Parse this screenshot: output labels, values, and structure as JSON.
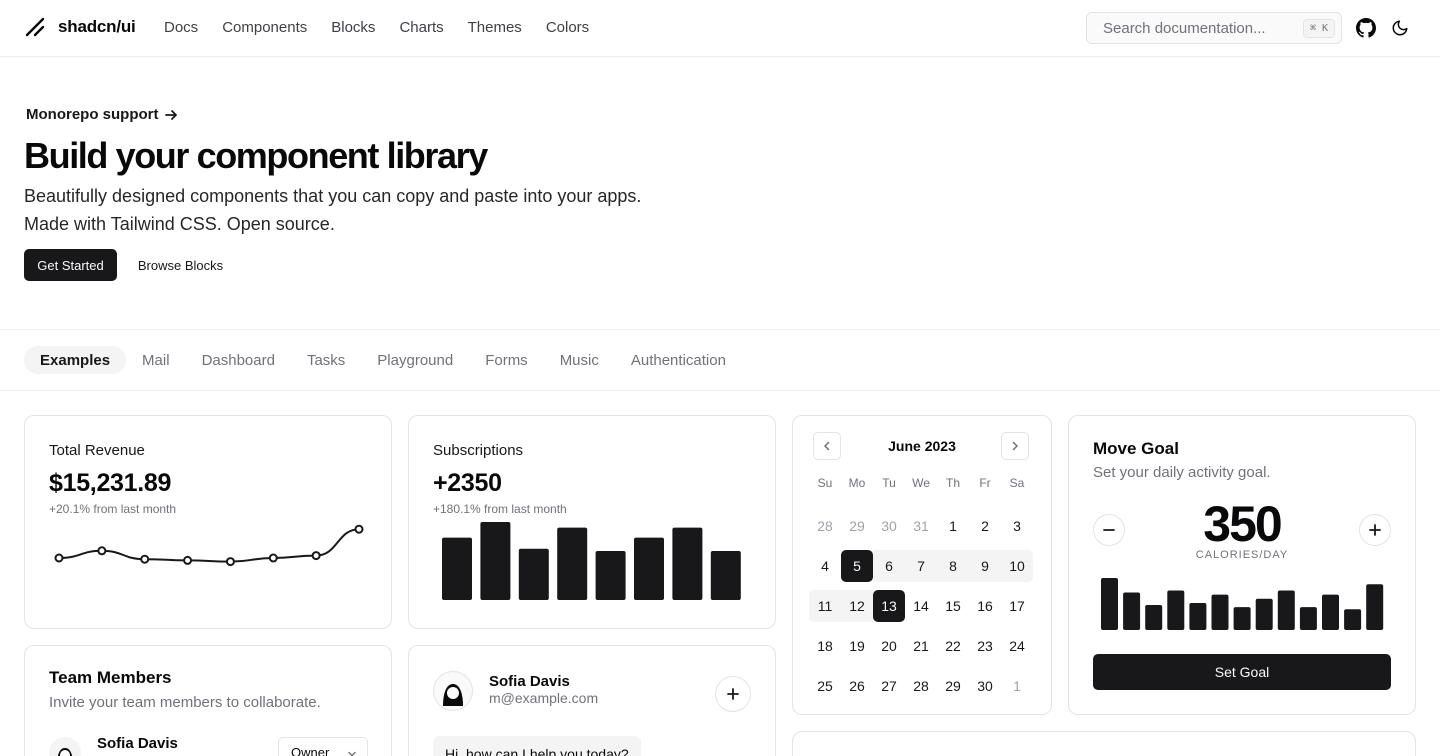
{
  "header": {
    "brand": "shadcn/ui",
    "nav": [
      "Docs",
      "Components",
      "Blocks",
      "Charts",
      "Themes",
      "Colors"
    ],
    "search_placeholder": "Search documentation...",
    "search_shortcut": "⌘ K"
  },
  "hero": {
    "announcement": "Monorepo support",
    "title": "Build your component library",
    "lead_line1": "Beautifully designed components that you can copy and paste into your apps.",
    "lead_line2": "Made with Tailwind CSS. Open source.",
    "primary_cta": "Get Started",
    "secondary_cta": "Browse Blocks"
  },
  "tabs": {
    "items": [
      "Examples",
      "Mail",
      "Dashboard",
      "Tasks",
      "Playground",
      "Forms",
      "Music",
      "Authentication"
    ],
    "active": "Examples"
  },
  "revenue": {
    "label": "Total Revenue",
    "value": "$15,231.89",
    "delta": "+20.1% from last month",
    "chart_data": {
      "type": "line",
      "values": [
        10,
        13,
        9.5,
        9,
        8.5,
        10,
        11,
        22
      ],
      "ylim": [
        0,
        25
      ]
    }
  },
  "subscriptions": {
    "label": "Subscriptions",
    "value": "+2350",
    "delta": "+180.1% from last month",
    "chart_data": {
      "type": "bar",
      "values": [
        56,
        70,
        46,
        65,
        44,
        56,
        65,
        44
      ],
      "ylim": [
        0,
        70
      ]
    }
  },
  "calendar": {
    "title": "June 2023",
    "weekdays": [
      "Su",
      "Mo",
      "Tu",
      "We",
      "Th",
      "Fr",
      "Sa"
    ],
    "weeks": [
      [
        "28",
        "29",
        "30",
        "31",
        "1",
        "2",
        "3"
      ],
      [
        "4",
        "5",
        "6",
        "7",
        "8",
        "9",
        "10"
      ],
      [
        "11",
        "12",
        "13",
        "14",
        "15",
        "16",
        "17"
      ],
      [
        "18",
        "19",
        "20",
        "21",
        "22",
        "23",
        "24"
      ],
      [
        "25",
        "26",
        "27",
        "28",
        "29",
        "30",
        "1"
      ]
    ]
  },
  "goal": {
    "title": "Move Goal",
    "description": "Set your daily activity goal.",
    "value": "350",
    "unit": "CALORIES/DAY",
    "button": "Set Goal",
    "chart_data": {
      "type": "bar",
      "values": [
        50,
        36,
        24,
        38,
        26,
        34,
        22,
        30,
        38,
        22,
        34,
        20,
        44
      ],
      "ylim": [
        0,
        50
      ]
    }
  },
  "team": {
    "title": "Team Members",
    "description": "Invite your team members to collaborate.",
    "member_name": "Sofia Davis",
    "member_role": "Owner"
  },
  "chat": {
    "name": "Sofia Davis",
    "email": "m@example.com",
    "message": "Hi, how can I help you today?"
  },
  "colors": {
    "primary": "#18181b",
    "muted": "#71717a",
    "border": "#e4e4e7",
    "accent_bg": "#f4f4f5"
  }
}
